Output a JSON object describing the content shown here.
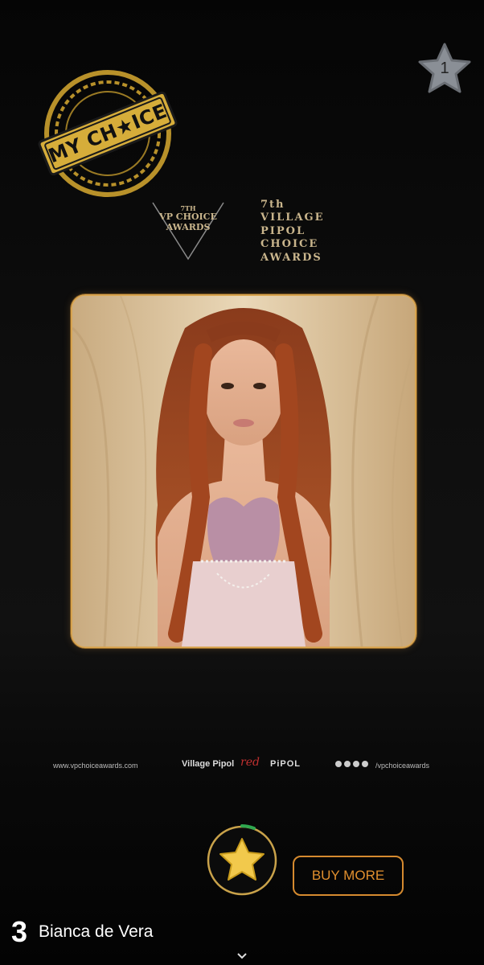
{
  "badge": {
    "count": "1",
    "icon": "star-icon"
  },
  "stamp": {
    "text": "MY CH★ICE"
  },
  "event_logo": {
    "line1": "7TH",
    "line2": "VP CHOICE",
    "line3": "AWARDS"
  },
  "event_title": {
    "lines": [
      "7th",
      "VILLAGE",
      "PIPOL",
      "CHOICE",
      "AWARDS"
    ]
  },
  "photo": {
    "subject": "nominee-portrait"
  },
  "footer": {
    "url": "www.vpchoiceawards.com",
    "brand": "Village Pipol",
    "red": "red",
    "pipol": "PiPOL",
    "handle": "/vpchoiceawards"
  },
  "actions": {
    "vote_icon": "star-icon",
    "buy_more": "BUY MORE"
  },
  "nominee": {
    "rank": "3",
    "name": "Bianca de Vera"
  },
  "colors": {
    "gold": "#d8a450",
    "accent_orange": "#e08f2e",
    "star_yellow": "#f2c94c"
  }
}
